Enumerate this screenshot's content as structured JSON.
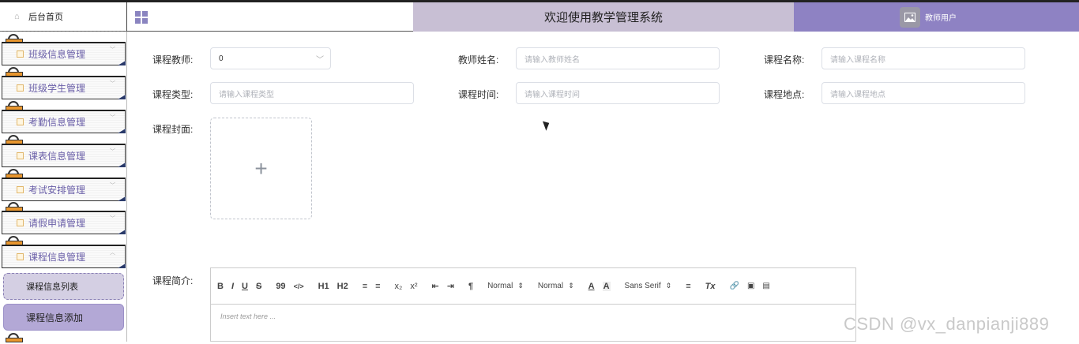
{
  "topbar": {
    "home_label": "后台首页",
    "title": "欢迎使用教学管理系统",
    "user_name": "教师用户"
  },
  "sidebar": {
    "items": [
      {
        "label": "班级信息管理"
      },
      {
        "label": "班级学生管理"
      },
      {
        "label": "考勤信息管理"
      },
      {
        "label": "课表信息管理"
      },
      {
        "label": "考试安排管理"
      },
      {
        "label": "请假申请管理"
      },
      {
        "label": "课程信息管理"
      }
    ],
    "sub_items": [
      {
        "label": "课程信息列表"
      },
      {
        "label": "课程信息添加"
      }
    ]
  },
  "form": {
    "teacher_label": "课程教师:",
    "teacher_value": "0",
    "teacher_name_label": "教师姓名:",
    "teacher_name_placeholder": "请输入教师姓名",
    "course_name_label": "课程名称:",
    "course_name_placeholder": "请输入课程名称",
    "course_type_label": "课程类型:",
    "course_type_placeholder": "请输入课程类型",
    "course_time_label": "课程时间:",
    "course_time_placeholder": "请输入课程时间",
    "course_place_label": "课程地点:",
    "course_place_placeholder": "请输入课程地点",
    "cover_label": "课程封面:",
    "upload_symbol": "+",
    "intro_label": "课程简介:"
  },
  "editor": {
    "toolbar": {
      "bold": "B",
      "italic": "I",
      "underline": "U",
      "strike": "S",
      "quote": "99",
      "code": "</>",
      "h1": "H1",
      "h2": "H2",
      "ol": "≡",
      "ul": "≡",
      "sub": "x₂",
      "sup": "x²",
      "indent_dec": "⇤",
      "indent_inc": "⇥",
      "direction": "¶",
      "size1": "Normal",
      "size2": "Normal",
      "color": "A",
      "bg": "A",
      "font": "Sans Serif",
      "align": "≡",
      "clean": "Tx"
    },
    "placeholder": "Insert text here ..."
  },
  "watermark": "CSDN @vx_danpianji889"
}
